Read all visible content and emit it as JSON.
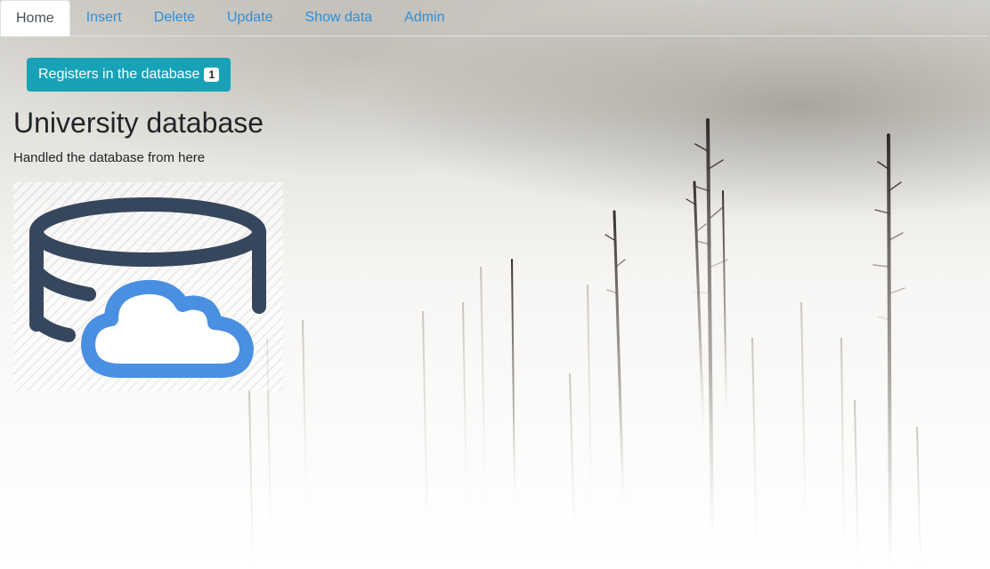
{
  "nav": {
    "tabs": [
      {
        "label": "Home",
        "active": true
      },
      {
        "label": "Insert",
        "active": false
      },
      {
        "label": "Delete",
        "active": false
      },
      {
        "label": "Update",
        "active": false
      },
      {
        "label": "Show data",
        "active": false
      },
      {
        "label": "Admin",
        "active": false
      }
    ]
  },
  "register_button": {
    "label": "Registers in the database",
    "count": "1"
  },
  "main": {
    "title": "University database",
    "subtitle": "Handled the database from here",
    "image_icon": "database-cloud-icon"
  },
  "colors": {
    "link": "#2f8fd8",
    "button_bg": "#17a2b8",
    "database_icon": "#36465d",
    "cloud_icon": "#4a90e2",
    "text": "#212529"
  }
}
